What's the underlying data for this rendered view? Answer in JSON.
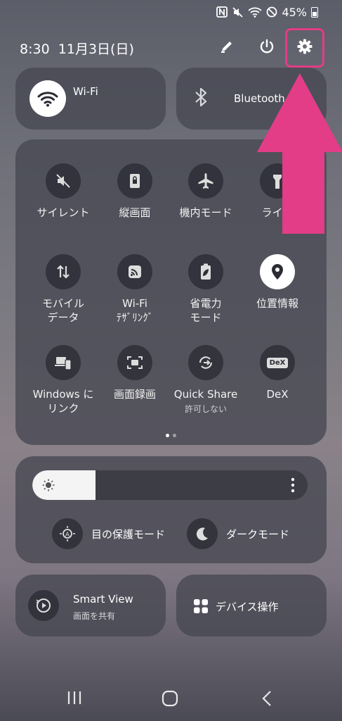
{
  "status_bar": {
    "battery_percent": "45%"
  },
  "header": {
    "time": "8:30",
    "date": "11月3日(日)"
  },
  "quick_toggles": {
    "wifi": {
      "label": "Wi-Fi",
      "active": true
    },
    "bluetooth": {
      "label": "Bluetooth",
      "active": false
    }
  },
  "tiles": [
    {
      "label": "サイレント",
      "icon": "mute-icon"
    },
    {
      "label": "縦画面",
      "icon": "portrait-lock-icon"
    },
    {
      "label": "機内モード",
      "icon": "airplane-icon"
    },
    {
      "label": "ライト",
      "icon": "flashlight-icon"
    },
    {
      "label": "モバイル\nデータ",
      "icon": "mobile-data-icon"
    },
    {
      "label": "Wi-Fi\nﾃｻﾞﾘﾝｸﾞ",
      "icon": "hotspot-icon"
    },
    {
      "label": "省電力\nモード",
      "icon": "power-saving-icon"
    },
    {
      "label": "位置情報",
      "icon": "location-icon"
    },
    {
      "label": "Windows に\nリンク",
      "icon": "link-to-windows-icon"
    },
    {
      "label": "画面録画",
      "icon": "screen-record-icon"
    },
    {
      "label": "Quick Share",
      "sub": "許可しない",
      "icon": "quick-share-icon"
    },
    {
      "label": "DeX",
      "icon": "dex-icon",
      "icon_text": "DeX"
    }
  ],
  "pager": {
    "current": 1,
    "total": 2
  },
  "brightness": {
    "level": 0.23
  },
  "modes": {
    "eye_comfort": "目の保護モード",
    "dark_mode": "ダークモード"
  },
  "bottom_cards": {
    "smart_view": {
      "title": "Smart View",
      "subtitle": "画面を共有"
    },
    "device_control": {
      "label": "デバイス操作"
    }
  },
  "colors": {
    "highlight": "#e23d86",
    "arrow": "#e23d86"
  }
}
